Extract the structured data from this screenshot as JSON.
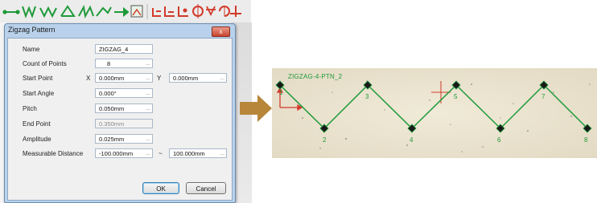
{
  "dialog": {
    "title": "Zigzag Pattern",
    "close_glyph": "x",
    "fields": {
      "name": {
        "label": "Name",
        "value": "ZIGZAG_4"
      },
      "count": {
        "label": "Count of Points",
        "value": "8"
      },
      "start_point": {
        "label": "Start Point",
        "x_label": "X",
        "x_value": "0.000mm",
        "y_label": "Y",
        "y_value": "0.000mm"
      },
      "start_angle": {
        "label": "Start Angle",
        "value": "0.000°"
      },
      "pitch": {
        "label": "Pitch",
        "value": "0.050mm"
      },
      "end_point": {
        "label": "End Point",
        "value": "0.350mm"
      },
      "amplitude": {
        "label": "Amplitude",
        "value": "0.025mm"
      },
      "measurable": {
        "label": "Measurable Distance",
        "from": "-100.000mm",
        "sep": "~",
        "to": "100.000mm"
      }
    },
    "ok_label": "OK",
    "cancel_label": "Cancel"
  },
  "preview": {
    "pattern_label": "ZIGZAG-4-PTN_2",
    "point_numbers": [
      "1",
      "2",
      "3",
      "4",
      "5",
      "6",
      "7",
      "8"
    ],
    "line_color": "#1f9a3a"
  },
  "toolbar": {
    "icon_names": [
      "line-icon",
      "zigzag-down-icon",
      "zigzag-icon",
      "triangle-icon",
      "sawtooth-icon",
      "polyline-icon",
      "arrow-right-icon",
      "image-icon",
      "step-icon",
      "step-down-icon",
      "corner-icon",
      "circle-icon",
      "star-icon",
      "rotate-icon",
      "cross-icon"
    ],
    "accent": "#1f9a3a",
    "red": "#d23a2a"
  }
}
